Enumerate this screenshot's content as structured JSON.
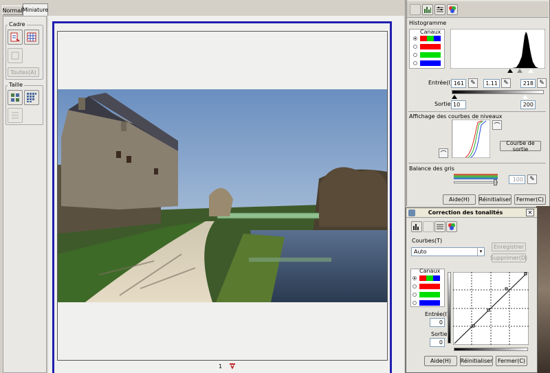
{
  "tabs": [
    "Normal",
    "Miniature"
  ],
  "left": {
    "cadre_label": "Cadre",
    "toutes_label": "Toutes(A)",
    "taille_label": "Taille"
  },
  "preview": {
    "page_number": "1"
  },
  "adjust_panel": {
    "histogram_label": "Histogramme",
    "canaux_label": "Canaux",
    "channels": [
      "#ff0000",
      "#00e000",
      "#0000ff"
    ],
    "entree_label": "Entrée(I):",
    "input_black": "161",
    "input_gamma": "1.11",
    "input_white": "218",
    "sortie_label": "Sortie:",
    "output_black": "10",
    "output_white": "200",
    "curves_label": "Affichage des courbes de niveaux",
    "courbe_button": "Courbe de sortie",
    "grey_label": "Balance des gris",
    "grey_value": "100",
    "aide": "Aide(H)",
    "reset": "Réinitialiser",
    "close": "Fermer(C)"
  },
  "tone_dialog": {
    "title": "Correction des tonalités",
    "courbes_label": "Courbes(T)",
    "preset": "Auto",
    "save": "Enregistrer",
    "delete": "Supprimer(D)",
    "canaux_label": "Canaux",
    "entree_label": "Entrée(I):",
    "entree_value": "0",
    "sortie_label": "Sortie:",
    "sortie_value": "0",
    "aide": "Aide(H)",
    "reset": "Réinitialiser",
    "close": "Fermer(C)"
  }
}
